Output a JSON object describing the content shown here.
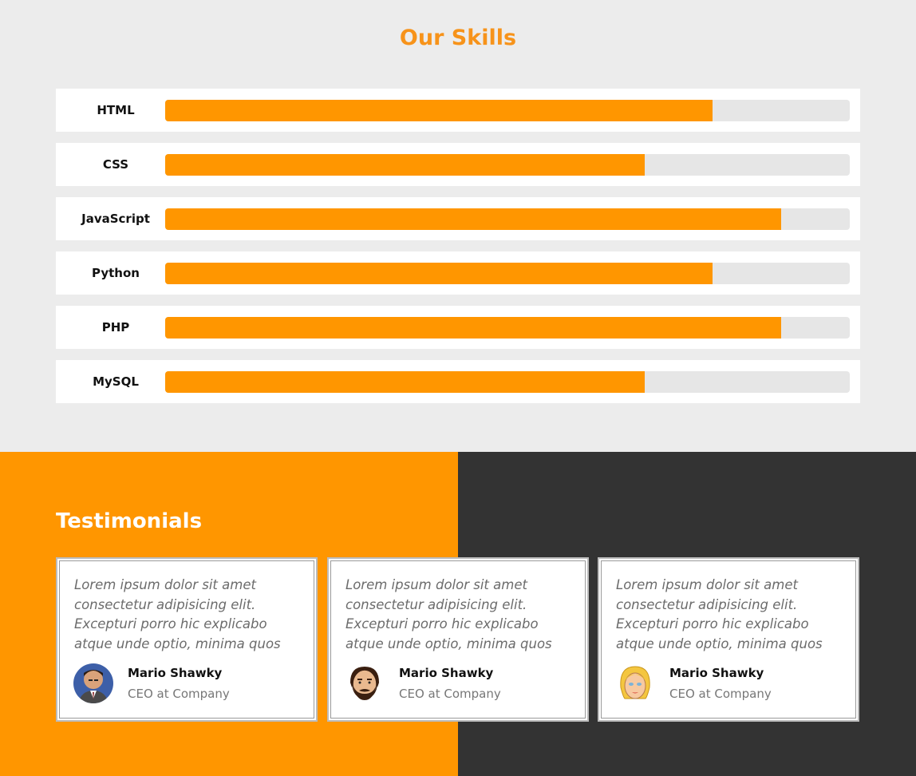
{
  "skills": {
    "title": "Our Skills",
    "accent_color": "#ff9600",
    "items": [
      {
        "name": "HTML",
        "level_percent": 80
      },
      {
        "name": "CSS",
        "level_percent": 70
      },
      {
        "name": "JavaScript",
        "level_percent": 90
      },
      {
        "name": "Python",
        "level_percent": 80
      },
      {
        "name": "PHP",
        "level_percent": 90
      },
      {
        "name": "MySQL",
        "level_percent": 70
      }
    ]
  },
  "testimonials": {
    "title": "Testimonials",
    "left_color": "#ff9600",
    "right_color": "#333333",
    "cards": [
      {
        "text": "Lorem ipsum dolor sit amet consectetur adipisicing elit. Excepturi porro hic explicabo atque unde optio, minima quos",
        "name": "Mario Shawky",
        "role": "CEO at Company",
        "avatar": "man-photo-avatar"
      },
      {
        "text": "Lorem ipsum dolor sit amet consectetur adipisicing elit. Excepturi porro hic explicabo atque unde optio, minima quos",
        "name": "Mario Shawky",
        "role": "CEO at Company",
        "avatar": "bearded-man-avatar"
      },
      {
        "text": "Lorem ipsum dolor sit amet consectetur adipisicing elit. Excepturi porro hic explicabo atque unde optio, minima quos",
        "name": "Mario Shawky",
        "role": "CEO at Company",
        "avatar": "blonde-woman-avatar"
      }
    ]
  }
}
